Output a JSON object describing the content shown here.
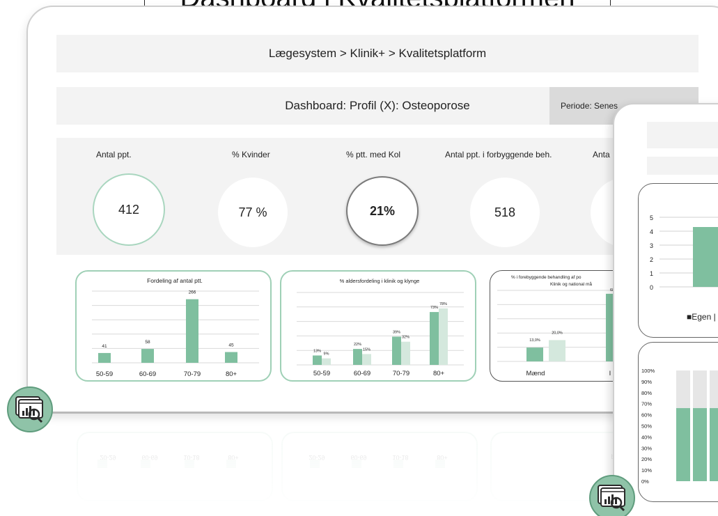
{
  "page_title": "Dashboard i Kvalitetsplatformen",
  "breadcrumb": "Lægesystem > Klinik+ > Kvalitetsplatform",
  "dashboard_title": "Dashboard: Profil (X): Osteoporose",
  "period_label": "Periode: Senes",
  "kpis": [
    {
      "label": "Antal ppt.",
      "value": "412"
    },
    {
      "label": "% Kvinder",
      "value": "77 %"
    },
    {
      "label": "% ptt. med Kol",
      "value": "21%"
    },
    {
      "label": "Antal ppt. i forbyggende beh.",
      "value": "518"
    },
    {
      "label": "Anta",
      "value": ""
    }
  ],
  "colors": {
    "accent": "#7fbf9f",
    "accent_light": "#d4e8dd",
    "panel": "#f3f3f3",
    "period_bg": "#dadada"
  },
  "chart_data": [
    {
      "type": "bar",
      "title": "Fordeling af antal ptt.",
      "categories": [
        "50-59",
        "60-69",
        "70-79",
        "80+"
      ],
      "values": [
        41,
        58,
        266,
        45
      ],
      "data_labels": [
        "41",
        "58",
        "266",
        "45"
      ],
      "grid": true
    },
    {
      "type": "bar",
      "title": "% aldersfordeling i klinik og klynge",
      "categories": [
        "50-59",
        "60-69",
        "70-79",
        "80+"
      ],
      "series": [
        {
          "values": [
            13,
            22,
            39,
            73
          ],
          "labels": [
            "13%",
            "22%",
            "39%",
            "73%"
          ]
        },
        {
          "values": [
            9,
            15,
            32,
            78
          ],
          "labels": [
            "9%",
            "15%",
            "32%",
            "78%"
          ]
        }
      ],
      "grid": true
    },
    {
      "type": "bar",
      "title": "% i forebyggende behandling af po",
      "subtitle": "Klinik og national må",
      "categories": [
        "Mænd",
        "I"
      ],
      "series": [
        {
          "values": [
            13.0,
            68
          ],
          "labels": [
            "13,0%",
            "68"
          ]
        },
        {
          "values": [
            20.0
          ],
          "labels": [
            "20,0%"
          ]
        }
      ],
      "grid": true
    },
    {
      "type": "bar",
      "title": "",
      "ylim": [
        0,
        5
      ],
      "yticks": [
        "0",
        "1",
        "2",
        "3",
        "4",
        "5"
      ],
      "values": [
        4.3
      ],
      "legend": [
        "Egen"
      ],
      "grid": true
    },
    {
      "type": "bar",
      "title": "",
      "ylim": [
        0,
        100
      ],
      "yticks": [
        "0%",
        "10%",
        "20%",
        "30%",
        "40%",
        "50%",
        "60%",
        "70%",
        "80%",
        "90%",
        "100%"
      ],
      "series": [
        {
          "values": [
            66,
            66,
            66
          ]
        },
        {
          "values": [
            34,
            34,
            34
          ]
        }
      ],
      "grid": false
    }
  ],
  "reflection_labels": [
    "20-29",
    "60-69",
    "10-18",
    "80+",
    "20-29",
    "60-69",
    "10-18",
    "80+",
    "pʇuɐɯ"
  ]
}
